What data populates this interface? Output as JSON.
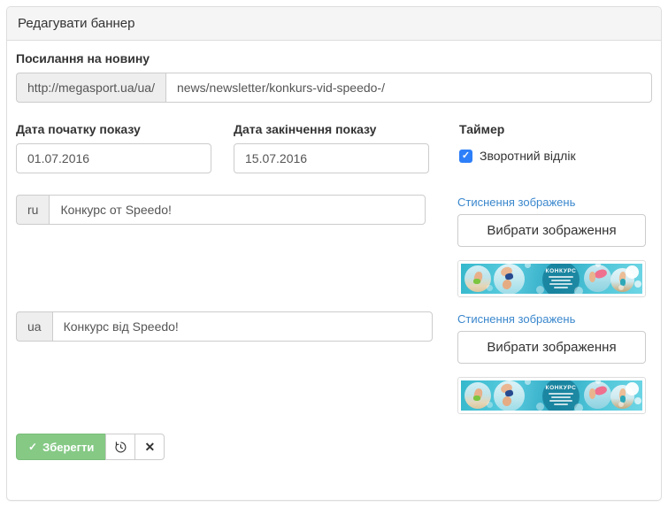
{
  "panel": {
    "title": "Редагувати баннер"
  },
  "news_link": {
    "label": "Посилання на новину",
    "prefix": "http://megasport.ua/ua/",
    "value": "news/newsletter/konkurs-vid-speedo-/"
  },
  "dates": {
    "start": {
      "label": "Дата початку показу",
      "value": "01.07.2016"
    },
    "end": {
      "label": "Дата закінчення показу",
      "value": "15.07.2016"
    }
  },
  "timer": {
    "label": "Таймер",
    "countdown_label": "Зворотний відлік",
    "checked": true,
    "check_glyph": "✓"
  },
  "title_ru": {
    "lang": "ru",
    "value": "Конкурс от Speedo!"
  },
  "title_ua": {
    "lang": "ua",
    "value": "Конкурс від Speedo!"
  },
  "image_tools": {
    "compress_link": "Стиснення зображень",
    "choose_button": "Вибрати зображення"
  },
  "banner_preview": {
    "headline": "КОНКУРС"
  },
  "actions": {
    "save_label": "Зберегти",
    "save_icon": "✓",
    "close_icon": "✕"
  },
  "colors": {
    "accent_green": "#85c985",
    "link_blue": "#3a87cd",
    "checkbox_blue": "#2d7ff9",
    "banner_teal": "#35b8cc",
    "panel_heading_bg": "#f5f5f5"
  }
}
